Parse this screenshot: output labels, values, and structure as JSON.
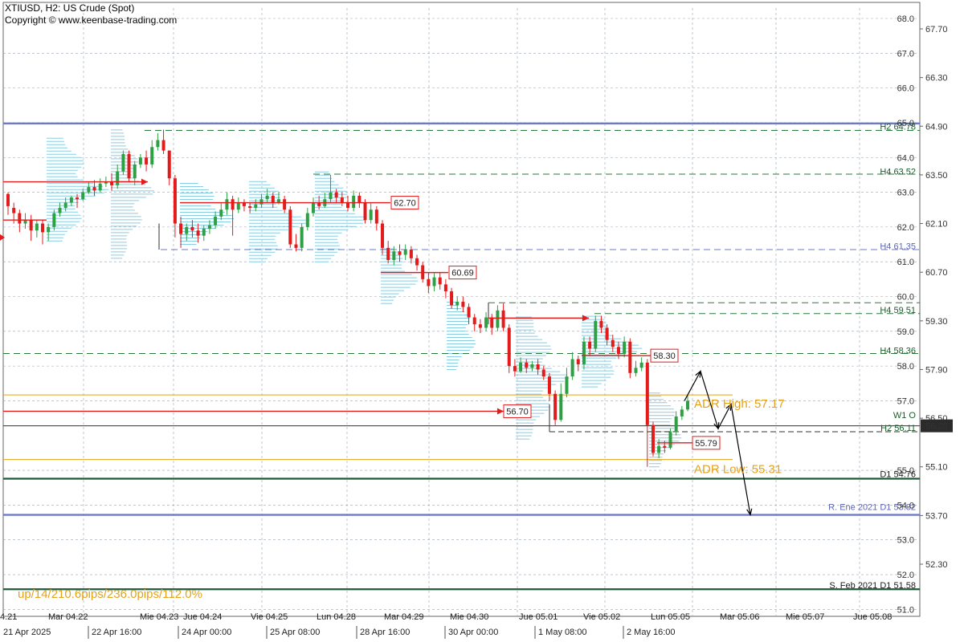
{
  "header": {
    "symbol_line": "XTIUSD, H2:  US Crude (Spot)",
    "copyright_line": "Copyright © www.keenbase-trading.com"
  },
  "colors": {
    "bull": "#2ea043",
    "bear": "#e31b1b",
    "grid": "#9aa3ad",
    "profile": "#87cde4",
    "h_level": "#2a7a3a",
    "blue_level": "#6f79c8",
    "dark_green": "#1e5a38",
    "adr": "#e3a21a",
    "price_box": "#2b2b2b"
  },
  "chart_data": {
    "type": "candlestick",
    "title": "XTIUSD, H2:  US Crude (Spot)",
    "ylim": [
      50.8,
      68.3
    ],
    "y_ticks": [
      "68.0",
      "67.70",
      "67.0",
      "66.30",
      "66.0",
      "65.0",
      "64.90",
      "64.0",
      "63.50",
      "63.0",
      "62.0",
      "62.10",
      "61.0",
      "60.70",
      "60.0",
      "59.30",
      "59.0",
      "58.0",
      "57.90",
      "57.0",
      "56.50",
      "55.0",
      "55.10",
      "54.0",
      "53.70",
      "53.0",
      "52.30",
      "52.0",
      "51.0"
    ],
    "x_labels": [
      "4.21",
      "21 Apr 2025",
      "Mar 04.22",
      "22 Apr 16:00",
      "Mie 04.23",
      "24 Apr 00:00",
      "Jue 04.24",
      "Vie 04.25",
      "25 Apr 08:00",
      "Lun 04.28",
      "28 Apr 16:00",
      "Mar 04.29",
      "30 Apr 00:00",
      "Mie 04.30",
      "Jue 05.01",
      "1 May 08:00",
      "Vie 05.02",
      "2 May 16:00",
      "Lun 05.05",
      "Mar 05.06",
      "Mie 05.07",
      "Jue 05.08"
    ],
    "current_price": "56.28",
    "candles": [
      [
        62.95,
        62.6,
        63.0,
        62.35
      ],
      [
        62.55,
        62.4,
        62.7,
        62.1
      ],
      [
        62.4,
        62.1,
        62.5,
        61.85
      ],
      [
        62.1,
        62.2,
        62.4,
        61.95
      ],
      [
        62.2,
        61.9,
        62.35,
        61.6
      ],
      [
        61.9,
        62.1,
        62.2,
        61.7
      ],
      [
        62.1,
        61.85,
        62.2,
        61.5
      ],
      [
        61.85,
        62.0,
        62.1,
        61.6
      ],
      [
        62.0,
        62.4,
        62.5,
        61.9
      ],
      [
        62.4,
        62.55,
        62.7,
        62.3
      ],
      [
        62.55,
        62.7,
        62.85,
        62.45
      ],
      [
        62.7,
        62.85,
        62.9,
        62.6
      ],
      [
        62.85,
        62.8,
        62.95,
        62.55
      ],
      [
        62.8,
        63.0,
        63.1,
        62.75
      ],
      [
        63.0,
        63.15,
        63.3,
        62.95
      ],
      [
        63.15,
        63.05,
        63.35,
        62.9
      ],
      [
        63.05,
        63.25,
        63.4,
        63.0
      ],
      [
        63.25,
        63.3,
        63.45,
        63.15
      ],
      [
        63.3,
        63.2,
        63.55,
        63.05
      ],
      [
        63.2,
        63.6,
        63.8,
        63.1
      ],
      [
        63.6,
        64.1,
        64.2,
        63.5
      ],
      [
        64.1,
        63.4,
        64.2,
        63.3
      ],
      [
        63.4,
        63.8,
        63.9,
        63.2
      ],
      [
        63.8,
        64.0,
        64.1,
        63.7
      ],
      [
        64.0,
        63.8,
        64.2,
        63.6
      ],
      [
        63.8,
        64.3,
        64.5,
        63.7
      ],
      [
        64.3,
        64.5,
        64.7,
        64.2
      ],
      [
        64.5,
        64.2,
        64.8,
        64.1
      ],
      [
        64.2,
        63.4,
        64.2,
        63.2
      ],
      [
        63.4,
        62.1,
        63.5,
        61.7
      ],
      [
        62.1,
        61.8,
        62.3,
        61.4
      ],
      [
        61.8,
        62.0,
        62.1,
        61.6
      ],
      [
        62.0,
        61.9,
        62.2,
        61.7
      ],
      [
        61.9,
        61.75,
        62.1,
        61.55
      ],
      [
        61.75,
        61.95,
        62.05,
        61.6
      ],
      [
        61.95,
        62.05,
        62.2,
        61.8
      ],
      [
        62.05,
        62.3,
        62.45,
        61.95
      ],
      [
        62.3,
        62.5,
        62.7,
        62.2
      ],
      [
        62.5,
        62.8,
        63.0,
        62.35
      ],
      [
        62.8,
        62.5,
        62.9,
        61.75
      ],
      [
        62.5,
        62.7,
        62.85,
        62.4
      ],
      [
        62.7,
        62.6,
        62.8,
        62.45
      ],
      [
        62.6,
        62.55,
        62.7,
        62.4
      ],
      [
        62.55,
        62.65,
        62.8,
        62.45
      ],
      [
        62.65,
        62.8,
        62.95,
        62.55
      ],
      [
        62.8,
        62.9,
        63.1,
        62.7
      ],
      [
        62.9,
        62.7,
        63.0,
        62.55
      ],
      [
        62.7,
        62.8,
        63.0,
        62.65
      ],
      [
        62.8,
        62.5,
        62.9,
        62.4
      ],
      [
        62.5,
        61.5,
        62.6,
        61.4
      ],
      [
        61.5,
        61.4,
        61.8,
        61.3
      ],
      [
        61.4,
        62.0,
        62.1,
        61.3
      ],
      [
        62.0,
        62.4,
        62.55,
        61.9
      ],
      [
        62.4,
        62.7,
        62.85,
        62.3
      ],
      [
        62.7,
        62.6,
        62.9,
        62.5
      ],
      [
        62.6,
        62.8,
        63.0,
        62.55
      ],
      [
        62.8,
        63.0,
        63.5,
        62.7
      ],
      [
        63.0,
        62.85,
        63.1,
        62.7
      ],
      [
        62.85,
        62.7,
        63.0,
        62.6
      ],
      [
        62.7,
        62.55,
        62.9,
        62.45
      ],
      [
        62.55,
        62.9,
        63.05,
        62.45
      ],
      [
        62.9,
        62.7,
        63.0,
        62.55
      ],
      [
        62.7,
        62.2,
        62.8,
        62.1
      ],
      [
        62.2,
        62.5,
        62.7,
        62.1
      ],
      [
        62.5,
        62.1,
        62.6,
        61.9
      ],
      [
        62.1,
        61.4,
        62.2,
        61.2
      ],
      [
        61.4,
        61.05,
        61.6,
        60.95
      ],
      [
        61.05,
        61.3,
        61.45,
        60.9
      ],
      [
        61.3,
        61.2,
        61.5,
        61.0
      ],
      [
        61.2,
        61.35,
        61.5,
        61.05
      ],
      [
        61.35,
        61.1,
        61.45,
        60.95
      ],
      [
        61.1,
        60.9,
        61.2,
        60.75
      ],
      [
        60.9,
        60.5,
        61.0,
        60.4
      ],
      [
        60.5,
        60.3,
        60.7,
        60.1
      ],
      [
        60.3,
        60.55,
        60.7,
        60.15
      ],
      [
        60.55,
        60.35,
        60.7,
        60.2
      ],
      [
        60.35,
        60.15,
        60.5,
        59.95
      ],
      [
        60.15,
        59.75,
        60.25,
        59.65
      ],
      [
        59.75,
        59.85,
        60.0,
        59.6
      ],
      [
        59.85,
        59.7,
        60.0,
        59.55
      ],
      [
        59.7,
        59.4,
        59.8,
        59.2
      ],
      [
        59.4,
        59.2,
        59.5,
        59.0
      ],
      [
        59.2,
        59.1,
        59.35,
        58.95
      ],
      [
        59.1,
        59.4,
        59.55,
        59.0
      ],
      [
        59.4,
        59.1,
        59.5,
        58.9
      ],
      [
        59.1,
        59.6,
        59.75,
        59.0
      ],
      [
        59.6,
        59.1,
        59.8,
        59.0
      ],
      [
        59.1,
        58.0,
        59.2,
        57.8
      ],
      [
        58.0,
        57.85,
        58.2,
        57.7
      ],
      [
        57.85,
        58.1,
        58.25,
        57.8
      ],
      [
        58.1,
        57.95,
        58.2,
        57.8
      ],
      [
        57.95,
        58.05,
        58.15,
        57.85
      ],
      [
        58.05,
        57.9,
        58.2,
        57.75
      ],
      [
        57.9,
        57.7,
        58.0,
        57.6
      ],
      [
        57.7,
        57.2,
        57.8,
        57.0
      ],
      [
        57.2,
        56.45,
        57.3,
        56.3
      ],
      [
        56.45,
        57.2,
        57.5,
        56.4
      ],
      [
        57.2,
        57.7,
        57.95,
        57.1
      ],
      [
        57.7,
        58.2,
        58.4,
        57.6
      ],
      [
        58.2,
        58.05,
        58.3,
        57.85
      ],
      [
        58.05,
        58.7,
        58.85,
        57.9
      ],
      [
        58.7,
        58.5,
        58.85,
        58.3
      ],
      [
        58.5,
        59.3,
        59.45,
        58.4
      ],
      [
        59.3,
        59.1,
        59.45,
        58.95
      ],
      [
        59.1,
        58.75,
        59.2,
        58.6
      ],
      [
        58.75,
        58.55,
        58.9,
        58.4
      ],
      [
        58.55,
        58.35,
        58.7,
        58.2
      ],
      [
        58.35,
        58.7,
        58.85,
        58.25
      ],
      [
        58.7,
        57.8,
        58.8,
        57.65
      ],
      [
        57.8,
        57.95,
        58.15,
        57.7
      ],
      [
        57.95,
        58.1,
        58.25,
        57.85
      ],
      [
        58.1,
        56.3,
        58.2,
        55.1
      ],
      [
        56.3,
        55.5,
        56.4,
        55.4
      ],
      [
        55.5,
        55.7,
        55.9,
        55.35
      ],
      [
        55.7,
        55.65,
        55.85,
        55.5
      ],
      [
        55.65,
        56.1,
        56.2,
        55.6
      ],
      [
        56.1,
        56.55,
        56.7,
        56.0
      ],
      [
        56.55,
        56.75,
        56.85,
        56.45
      ],
      [
        56.75,
        57.0,
        57.15,
        56.7
      ]
    ],
    "levels": [
      {
        "label": "H2 64.78",
        "value": 64.78,
        "style": "h"
      },
      {
        "label": "H4 63.52",
        "value": 63.52,
        "style": "h"
      },
      {
        "label": "H4 61.35",
        "value": 61.35,
        "style": "blue"
      },
      {
        "label": "H4 59.51",
        "value": 59.51,
        "style": "h"
      },
      {
        "label": "H4 58.36",
        "value": 58.36,
        "style": "h"
      },
      {
        "label": "W1 O",
        "value": 56.45,
        "style": "h"
      },
      {
        "label": "H2 56.11",
        "value": 56.11,
        "style": "h"
      },
      {
        "label": "D1 54.76",
        "value": 54.76,
        "style": "dark"
      },
      {
        "label": "R. Ene 2021 D1 53.82",
        "value": 53.82,
        "style": "blue"
      },
      {
        "label": "S. Feb 2021 D1 51.58",
        "value": 51.58,
        "style": "dark"
      }
    ],
    "price_boxes": [
      "62.70",
      "60.69",
      "58.30",
      "56.70",
      "55.79"
    ],
    "adr_high": "ADR High: 57.17",
    "adr_low": "ADR Low: 55.31",
    "stats": "up/14/210.6pips/236.0pips/112.0%"
  }
}
